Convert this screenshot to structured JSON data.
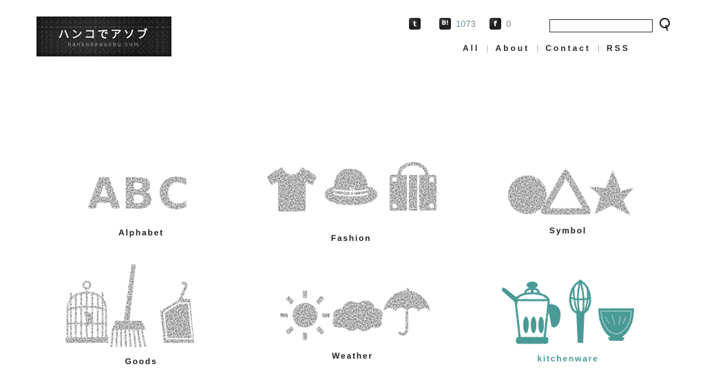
{
  "site": {
    "logo_kana": "ハンコでアソブ",
    "logo_url": "hankodeasobu.com"
  },
  "header": {
    "social": [
      {
        "icon": "twitter-icon",
        "glyph": "t",
        "count": ""
      },
      {
        "icon": "hatena-bookmark-icon",
        "glyph": "B!",
        "count": "1073"
      },
      {
        "icon": "facebook-icon",
        "glyph": "f",
        "count": "0"
      }
    ],
    "search": {
      "value": "",
      "placeholder": "",
      "icon": "search-icon"
    },
    "nav": [
      {
        "label": "All"
      },
      {
        "label": "About"
      },
      {
        "label": "Contact"
      },
      {
        "label": "RSS"
      }
    ],
    "nav_separator": "|"
  },
  "categories": [
    {
      "label": "Alphabet",
      "art": "abc-letters",
      "color": "#111111"
    },
    {
      "label": "Fashion",
      "art": "tshirt-hat-suitcase",
      "color": "#111111"
    },
    {
      "label": "Symbol",
      "art": "circle-triangle-star",
      "color": "#111111"
    },
    {
      "label": "Goods",
      "art": "birdcage-broom-dustpan",
      "color": "#111111"
    },
    {
      "label": "Weather",
      "art": "sun-cloud-umbrella",
      "color": "#111111"
    },
    {
      "label": "kitchenware",
      "art": "kettle-whisk-bowl",
      "color": "#4a9a96"
    }
  ],
  "colors": {
    "background": "#ffffff",
    "ink": "#111111",
    "teal": "#4a9a96",
    "count_text": "#7b8a96",
    "nav_text": "#2c2c2c"
  }
}
